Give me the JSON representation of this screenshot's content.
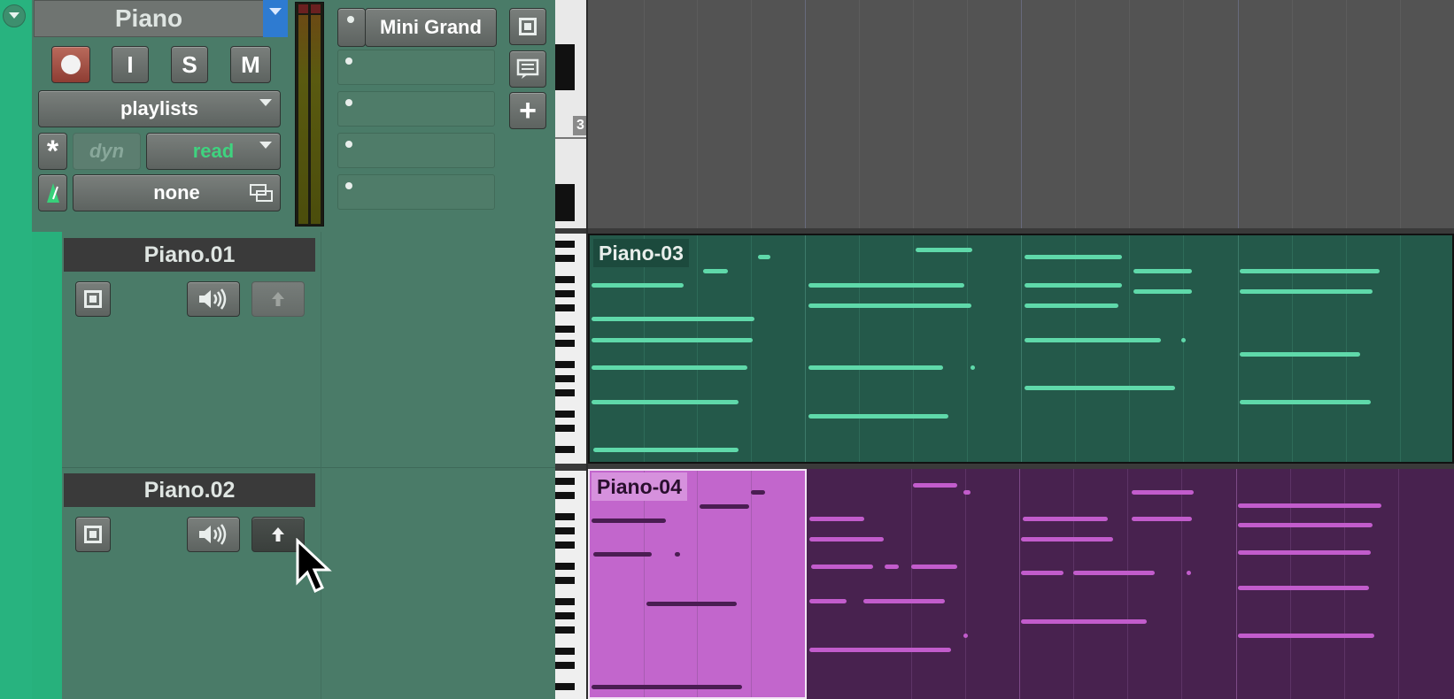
{
  "track": {
    "name": "Piano",
    "record_button": "record",
    "input_button": "I",
    "solo_button": "S",
    "mute_button": "M",
    "playlists_label": "playlists",
    "automation_dyn": "dyn",
    "automation_mode": "read",
    "group_label": "none",
    "insert_instrument": "Mini Grand",
    "timeline_marker": "3"
  },
  "sublanes": [
    {
      "name": "Piano.01"
    },
    {
      "name": "Piano.02"
    }
  ],
  "clips": {
    "green": "Piano-03",
    "purple": "Piano-04"
  },
  "colors": {
    "track_accent": "#28b37f",
    "mixer_bg": "#4a7b68",
    "clip_green_bg": "#24594a",
    "note_green": "#5fd9aa",
    "clip_purple_bg": "#48224f",
    "clip_purple_selected_bg": "#c266cc",
    "note_purple": "#c25ccc",
    "read_text": "#3fd37f"
  },
  "icons": [
    "chevron-down-icon",
    "record-icon",
    "list-icon",
    "comment-icon",
    "plus-icon",
    "speaker-icon",
    "up-arrow-icon",
    "asterisk-icon",
    "metronome-icon",
    "link-icon",
    "cursor-icon"
  ]
}
